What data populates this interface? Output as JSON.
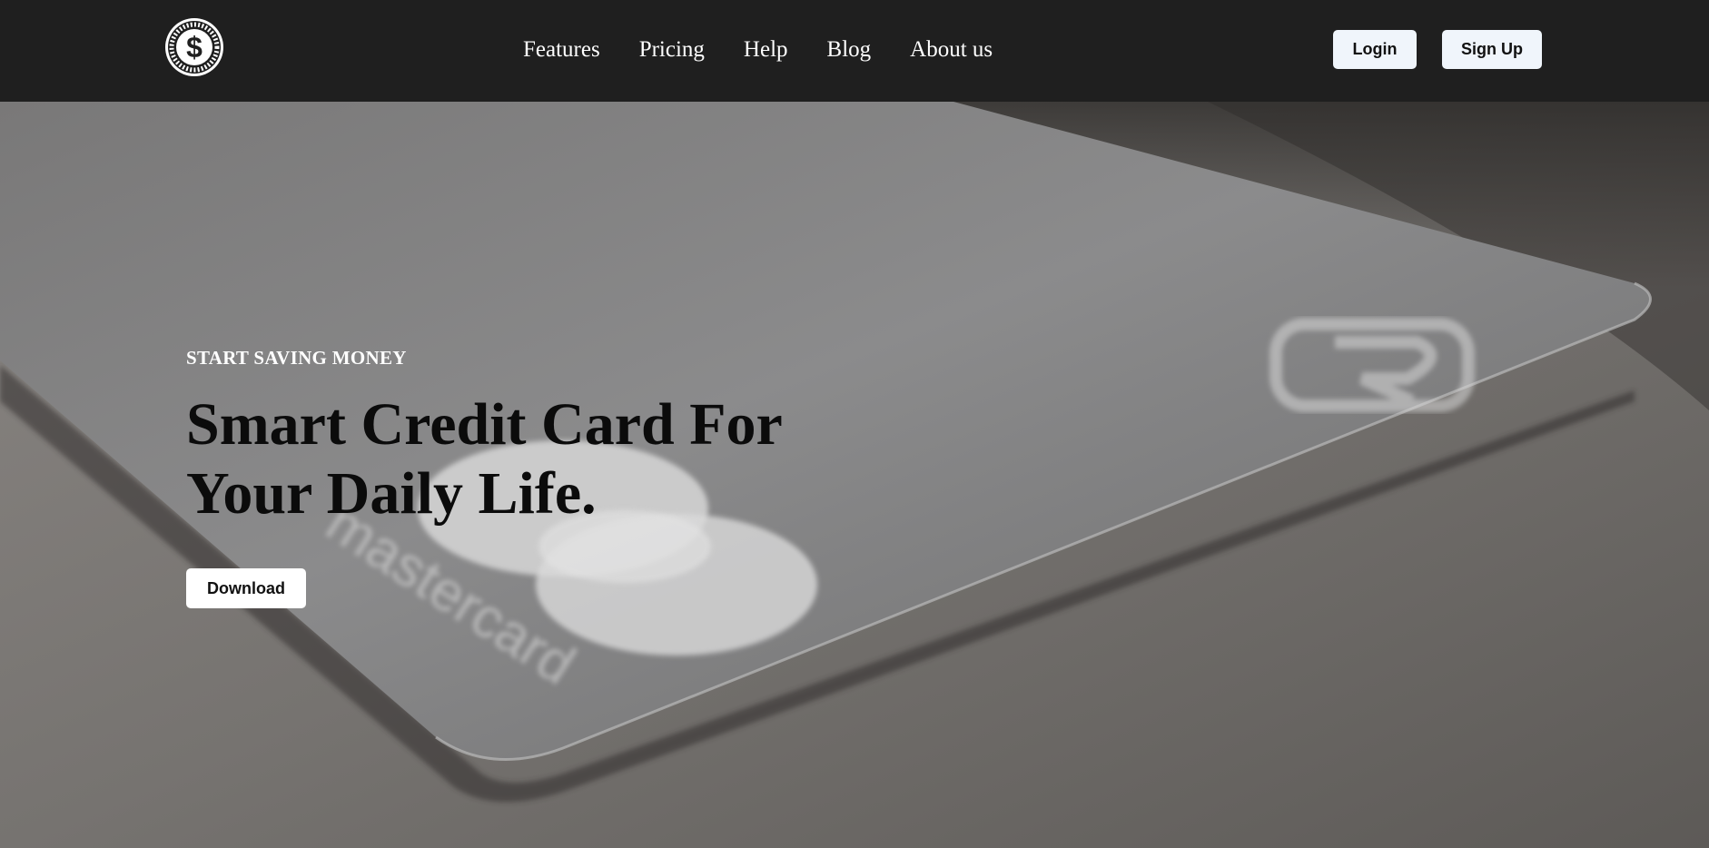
{
  "navbar": {
    "logo_icon": "dollar-coin-icon",
    "links": [
      "Features",
      "Pricing",
      "Help",
      "Blog",
      "About us"
    ],
    "login_label": "Login",
    "signup_label": "Sign Up"
  },
  "hero": {
    "eyebrow": "START SAVING MONEY",
    "title_line1": "Smart Credit Card For",
    "title_line2": "Your Daily Life.",
    "download_label": "Download",
    "card_brand_text": "mastercard"
  },
  "colors": {
    "nav_background": "#1f1f1f",
    "button_background": "#f0f5fb",
    "title_text": "#0b0b0b"
  }
}
